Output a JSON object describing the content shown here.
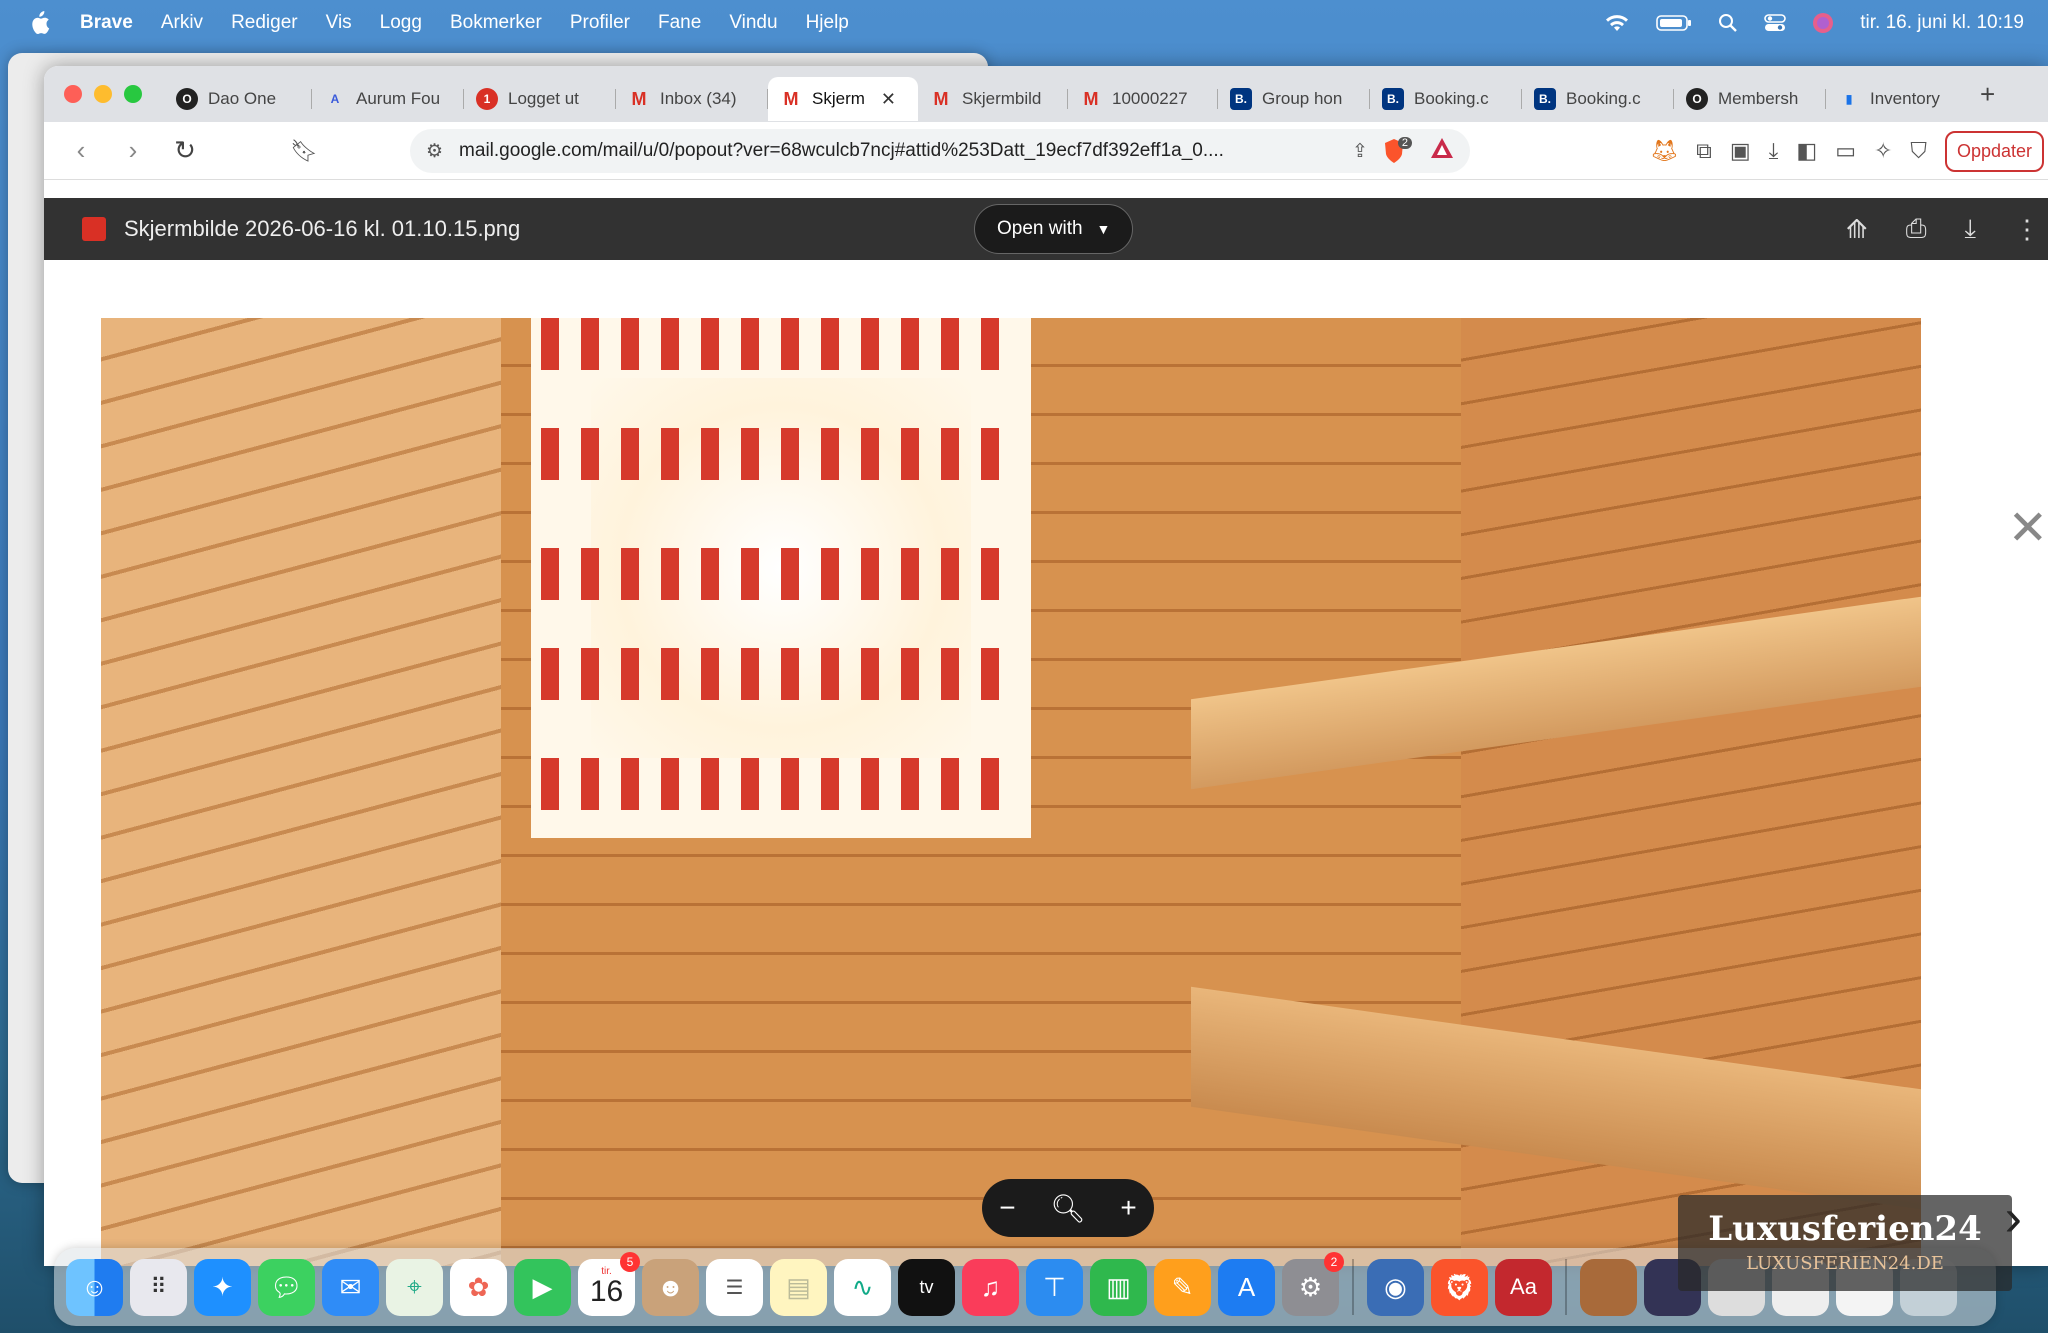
{
  "menubar": {
    "app": "Brave",
    "items": [
      "Arkiv",
      "Rediger",
      "Vis",
      "Logg",
      "Bokmerker",
      "Profiler",
      "Fane",
      "Vindu",
      "Hjelp"
    ],
    "datetime": "tir. 16. juni kl. 10:19"
  },
  "tabs": [
    {
      "label": "Dao One",
      "icon": "circle-logo-icon",
      "color": "#222222"
    },
    {
      "label": "Aurum Fou",
      "icon": "aurum-logo-icon",
      "color": "#3b5bdb"
    },
    {
      "label": "Logget ut",
      "icon": "alert-icon",
      "color": "#d93025"
    },
    {
      "label": "Inbox (34)",
      "icon": "gmail-icon",
      "color": "#d93025"
    },
    {
      "label": "Skjerm",
      "icon": "gmail-icon",
      "color": "#d93025",
      "active": true
    },
    {
      "label": "Skjermbild",
      "icon": "gmail-icon",
      "color": "#d93025"
    },
    {
      "label": "10000227",
      "icon": "gmail-icon",
      "color": "#d93025"
    },
    {
      "label": "Group hon",
      "icon": "booking-icon",
      "color": "#003580"
    },
    {
      "label": "Booking.c",
      "icon": "booking-icon",
      "color": "#003580"
    },
    {
      "label": "Booking.c",
      "icon": "booking-icon",
      "color": "#003580"
    },
    {
      "label": "Membersh",
      "icon": "circle-logo-icon",
      "color": "#222222"
    },
    {
      "label": "Inventory",
      "icon": "chart-icon",
      "color": "#1a73e8"
    }
  ],
  "toolbar": {
    "url": "mail.google.com/mail/u/0/popout?ver=68wculcb7ncj#attid%253Datt_19ecf7df392eff1a_0....",
    "update_label": "Oppdater",
    "shield_badge": "2"
  },
  "viewer": {
    "filename": "Skjermbilde 2026-06-16 kl. 01.10.15.png",
    "open_with": "Open with"
  },
  "dock": {
    "calendar_month": "tir.",
    "calendar_day": "16",
    "calendar_badge": "5",
    "settings_badge": "2",
    "dict_label": "Aa",
    "tv_label": "tv"
  },
  "watermark": {
    "title": "Luxusferien24",
    "subtitle": "LUXUSFERIEN24.DE"
  }
}
